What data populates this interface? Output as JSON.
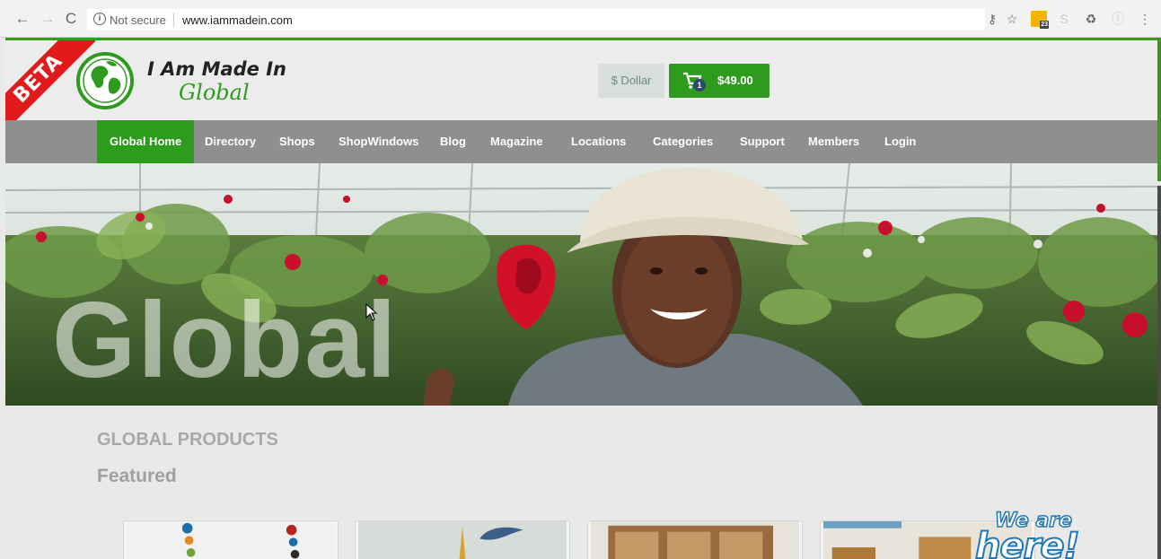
{
  "browser": {
    "back_icon": "back-arrow-icon",
    "forward_icon": "forward-arrow-icon",
    "reload_icon": "reload-icon",
    "security_label": "Not secure",
    "url": "www.iammadein.com",
    "calendar_badge": "23"
  },
  "header": {
    "beta_label": "BETA",
    "logo_title": "I Am Made In",
    "logo_subtitle": "Global",
    "currency_label": "$ Dollar",
    "cart_count": "1",
    "cart_total": "$49.00"
  },
  "nav": {
    "items": [
      {
        "label": "Global Home",
        "active": true
      },
      {
        "label": "Directory"
      },
      {
        "label": "Shops"
      },
      {
        "label": "ShopWindows"
      },
      {
        "label": "Blog"
      },
      {
        "label": "Magazine"
      },
      {
        "label": "Locations"
      },
      {
        "label": "Categories"
      },
      {
        "label": "Support"
      },
      {
        "label": "Members"
      },
      {
        "label": "Login"
      }
    ]
  },
  "hero": {
    "overlay_word": "Global"
  },
  "products": {
    "section_title": "GLOBAL PRODUCTS",
    "subheading": "Featured"
  },
  "badge": {
    "line1": "We are",
    "line2": "here!"
  },
  "colors": {
    "brand_green": "#2e9a1e",
    "nav_gray": "#8f8f8f",
    "beta_red": "#e11b1b"
  }
}
